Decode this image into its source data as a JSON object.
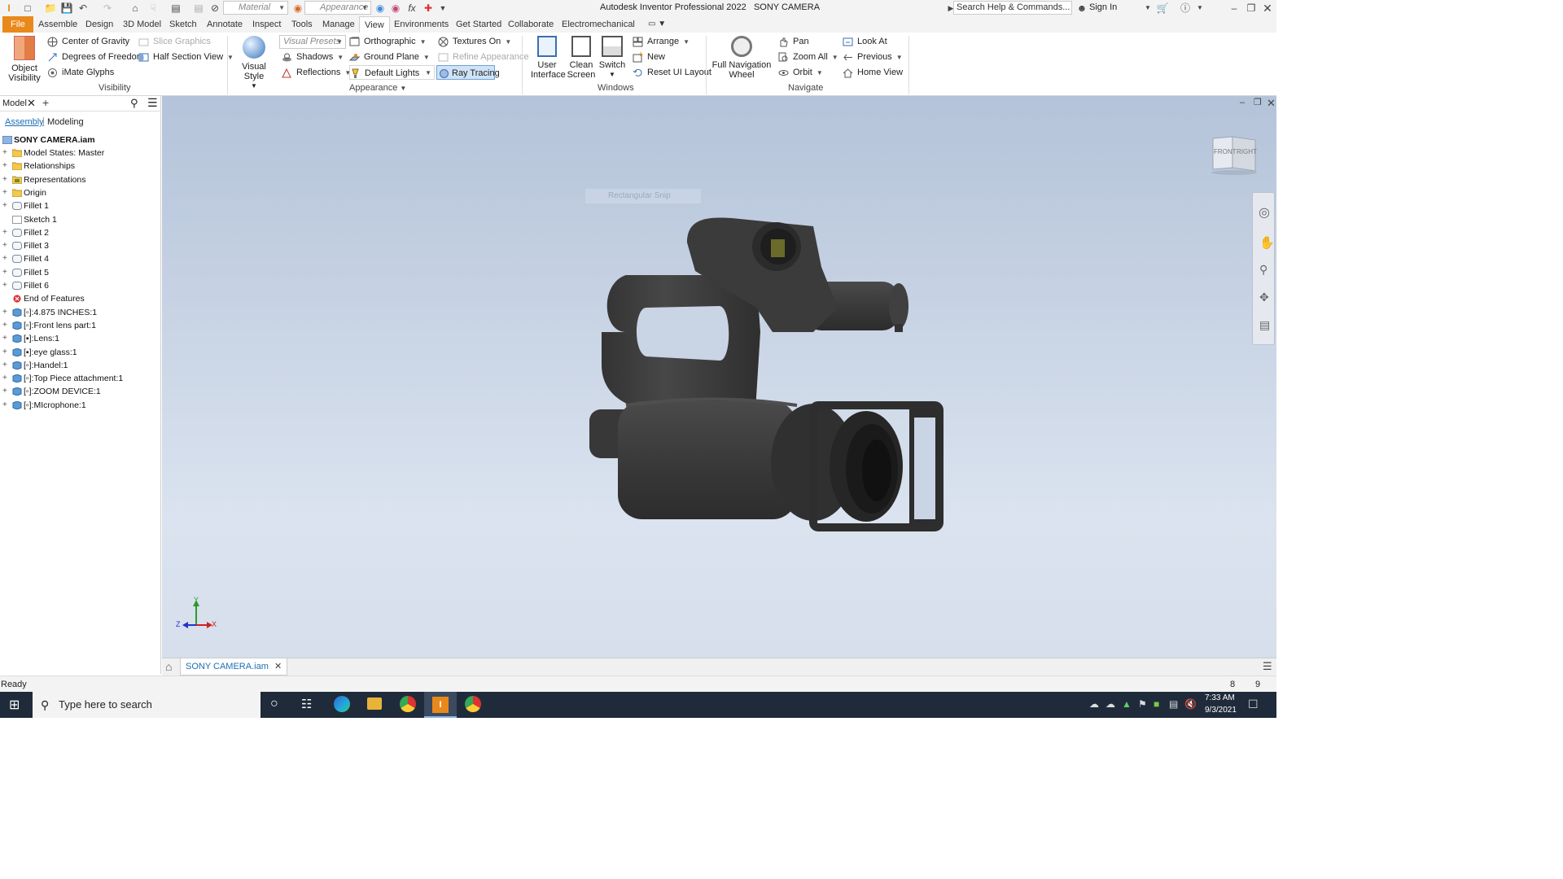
{
  "titlebar": {
    "material_placeholder": "Material",
    "appearance_placeholder": "Appearance",
    "app_title": "Autodesk Inventor Professional 2022",
    "doc_title": "SONY CAMERA",
    "search_placeholder": "Search Help & Commands...",
    "sign_in": "Sign In"
  },
  "menu": {
    "tabs": [
      "File",
      "Assemble",
      "Design",
      "3D Model",
      "Sketch",
      "Annotate",
      "Inspect",
      "Tools",
      "Manage",
      "View",
      "Environments",
      "Get Started",
      "Collaborate",
      "Electromechanical"
    ],
    "active": "View"
  },
  "ribbon": {
    "visibility": {
      "object_visibility_l1": "Object",
      "object_visibility_l2": "Visibility",
      "center_of_gravity": "Center of Gravity",
      "degrees_of_freedom": "Degrees of Freedom",
      "imate_glyphs": "iMate Glyphs",
      "slice_graphics": "Slice Graphics",
      "half_section_view": "Half Section View",
      "label": "Visibility"
    },
    "appearance": {
      "visual_style": "Visual Style",
      "visual_presets": "Visual Presets",
      "shadows": "Shadows",
      "reflections": "Reflections",
      "orthographic": "Orthographic",
      "ground_plane": "Ground Plane",
      "default_lights": "Default Lights",
      "textures_on": "Textures On",
      "refine_appearance": "Refine Appearance",
      "ray_tracing": "Ray Tracing",
      "label": "Appearance"
    },
    "windows": {
      "user_interface_l1": "User",
      "user_interface_l2": "Interface",
      "clean_screen_l1": "Clean",
      "clean_screen_l2": "Screen",
      "switch": "Switch",
      "arrange": "Arrange",
      "new": "New",
      "reset_ui_layout": "Reset UI Layout",
      "label": "Windows"
    },
    "navigate": {
      "full_nav_wheel_l1": "Full Navigation",
      "full_nav_wheel_l2": "Wheel",
      "pan": "Pan",
      "zoom_all": "Zoom All",
      "orbit": "Orbit",
      "look_at": "Look At",
      "previous": "Previous",
      "home_view": "Home View",
      "label": "Navigate"
    }
  },
  "browser": {
    "tab": "Model",
    "assembly": "Assembly",
    "modeling": "Modeling",
    "root": "SONY CAMERA.iam",
    "items": [
      {
        "label": "Model States: Master",
        "icon": "folder",
        "pm": "+"
      },
      {
        "label": "Relationships",
        "icon": "folder",
        "pm": "+"
      },
      {
        "label": "Representations",
        "icon": "rep",
        "pm": "+"
      },
      {
        "label": "Origin",
        "icon": "folder",
        "pm": "+"
      },
      {
        "label": "Fillet 1",
        "icon": "feature",
        "pm": "+"
      },
      {
        "label": "Sketch 1",
        "icon": "sketch",
        "pm": ""
      },
      {
        "label": "Fillet 2",
        "icon": "feature",
        "pm": "+"
      },
      {
        "label": "Fillet 3",
        "icon": "feature",
        "pm": "+"
      },
      {
        "label": "Fillet 4",
        "icon": "feature",
        "pm": "+"
      },
      {
        "label": "Fillet 5",
        "icon": "feature",
        "pm": "+"
      },
      {
        "label": "Fillet 6",
        "icon": "feature",
        "pm": "+"
      },
      {
        "label": "End of Features",
        "icon": "end",
        "pm": ""
      },
      {
        "label": "[▫]:4.875 INCHES:1",
        "icon": "part",
        "pm": "+"
      },
      {
        "label": "[▫]:Front lens part:1",
        "icon": "part",
        "pm": "+"
      },
      {
        "label": "[▪]:Lens:1",
        "icon": "part",
        "pm": "+"
      },
      {
        "label": "[▪]:eye glass:1",
        "icon": "part",
        "pm": "+"
      },
      {
        "label": "[▫]:Handel:1",
        "icon": "part",
        "pm": "+"
      },
      {
        "label": "[▫]:Top Piece attachment:1",
        "icon": "part",
        "pm": "+"
      },
      {
        "label": "[▫]:ZOOM DEVICE:1",
        "icon": "part",
        "pm": "+"
      },
      {
        "label": "[▫]:MIcrophone:1",
        "icon": "part",
        "pm": "+"
      }
    ]
  },
  "viewport": {
    "viewcube_front": "FRONT",
    "viewcube_right": "RIGHT",
    "snip_hint": "Rectangular Snip",
    "axis_x": "X",
    "axis_y": "Y",
    "axis_z": "Z"
  },
  "doc_tab": "SONY CAMERA.iam",
  "status": {
    "text": "Ready",
    "count1": "8",
    "count2": "9"
  },
  "taskbar": {
    "search_placeholder": "Type here to search",
    "time": "7:33 AM",
    "date": "9/3/2021"
  },
  "colors": {
    "accent": "#e9891b",
    "active_tab_text": "#1c6fb5",
    "viewport_top": "#b4c3d9",
    "viewport_bottom": "#d6dfeb",
    "taskbar": "#1f2b3a",
    "camera_body": "#3a3a3a"
  }
}
